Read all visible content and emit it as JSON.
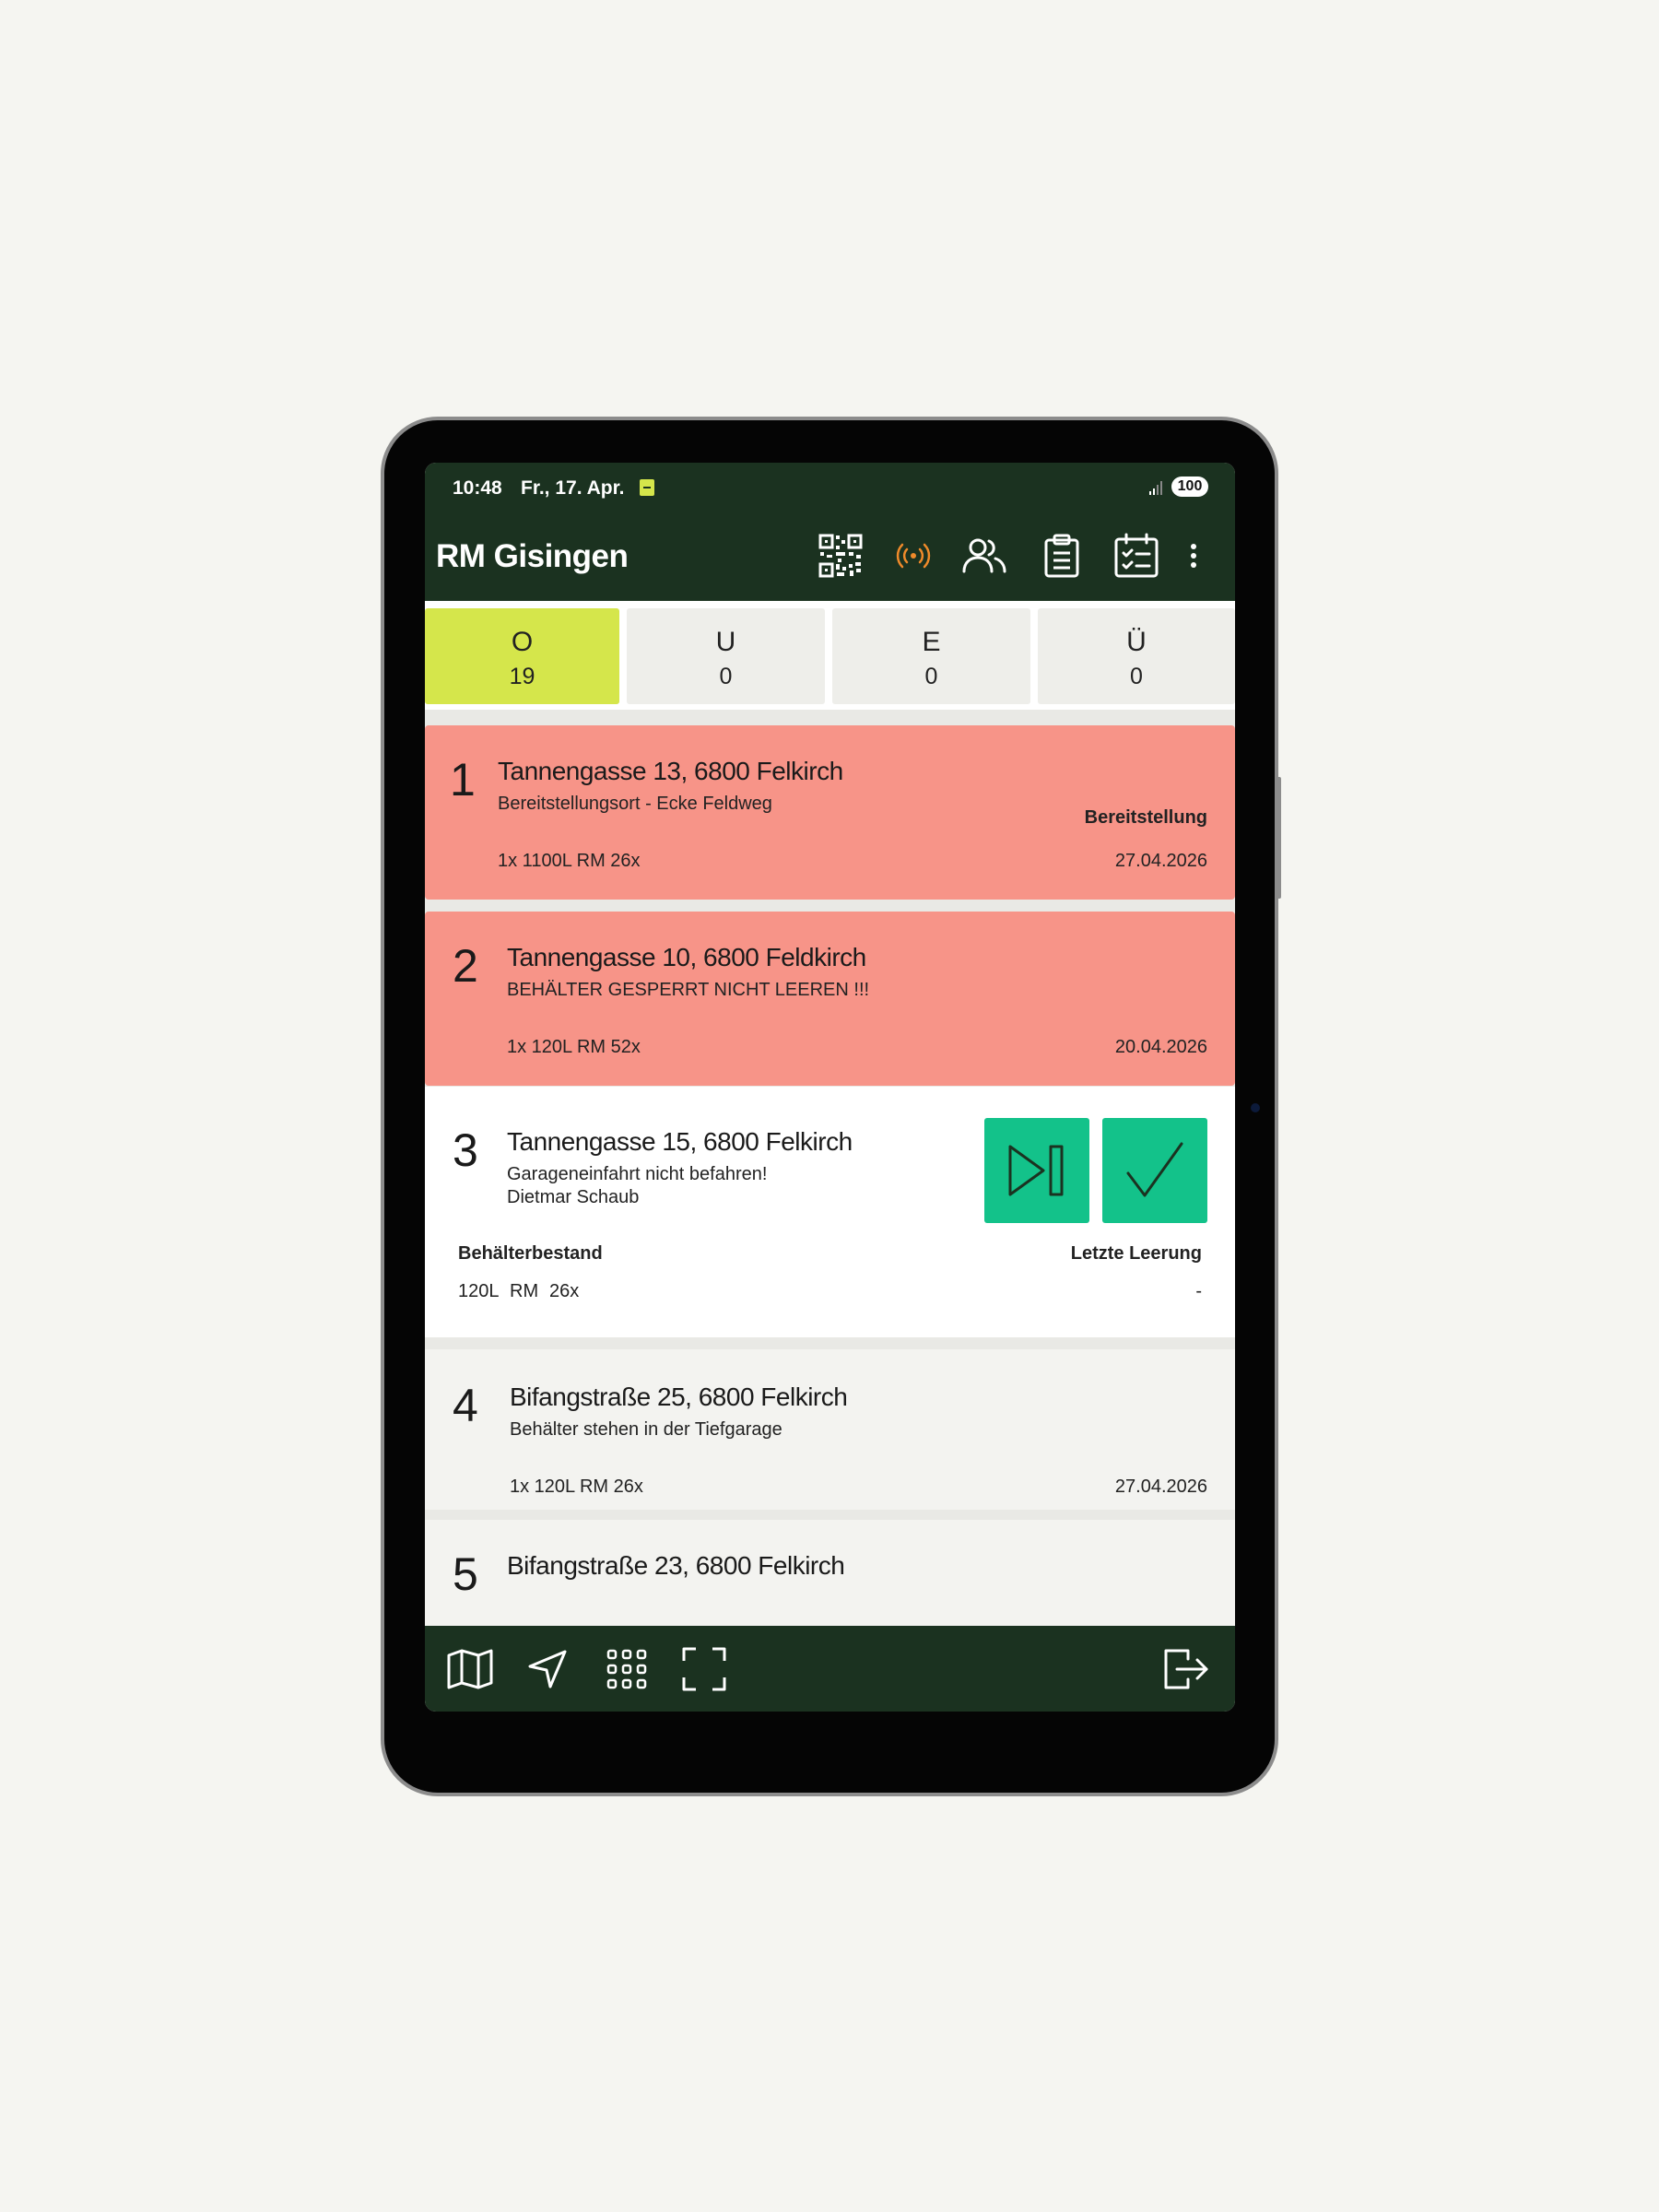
{
  "status": {
    "time": "10:48",
    "date": "Fr., 17. Apr.",
    "battery": "100"
  },
  "app": {
    "title": "RM Gisingen",
    "icons": [
      "qr-code-icon",
      "broadcast-icon",
      "users-icon",
      "clipboard-icon",
      "calendar-checklist-icon",
      "more-vert-icon"
    ],
    "accent_color": "#d5e64b",
    "header_color": "#1b3220",
    "alert_color": "#f79488",
    "action_color": "#13c28a"
  },
  "tabs": [
    {
      "letter": "O",
      "count": "19"
    },
    {
      "letter": "U",
      "count": "0"
    },
    {
      "letter": "E",
      "count": "0"
    },
    {
      "letter": "Ü",
      "count": "0"
    }
  ],
  "stops": [
    {
      "number": "1",
      "address": "Tannengasse 13, 6800 Felkirch",
      "note": "Bereitstellungsort - Ecke Feldweg",
      "tag": "Bereitstellung",
      "containers": "1x 1100L RM 26x",
      "date": "27.04.2026"
    },
    {
      "number": "2",
      "address": "Tannengasse 10, 6800 Feldkirch",
      "note": "BEHÄLTER GESPERRT NICHT LEEREN !!!",
      "containers": "1x 120L RM 52x",
      "date": "20.04.2026"
    },
    {
      "number": "3",
      "address": "Tannengasse 15, 6800 Felkirch",
      "note": "Garageneinfahrt nicht befahren!",
      "person": "Dietmar Schaub",
      "stock_label": "Behälterbestand",
      "last_label": "Letzte Leerung",
      "stock": {
        "size": "120L",
        "type": "RM",
        "count": "26x"
      },
      "last": "-"
    },
    {
      "number": "4",
      "address": "Bifangstraße 25, 6800 Felkirch",
      "note": "Behälter stehen in der Tiefgarage",
      "containers": "1x 120L RM 26x",
      "date": "27.04.2026"
    },
    {
      "number": "5",
      "address": "Bifangstraße 23, 6800 Felkirch"
    }
  ],
  "bottom_icons": [
    "map-icon",
    "navigation-icon",
    "apps-grid-icon",
    "scan-frame-icon",
    "logout-icon"
  ]
}
